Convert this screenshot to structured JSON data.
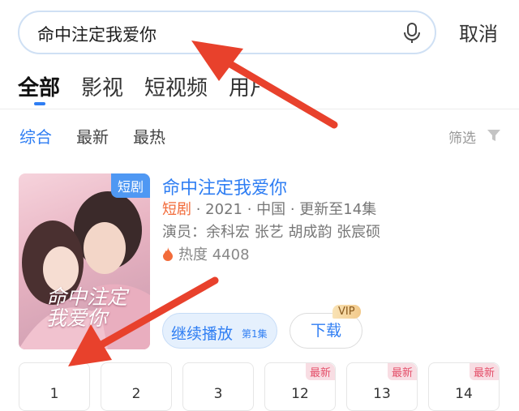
{
  "search": {
    "query": "命中注定我爱你",
    "cancel_label": "取消"
  },
  "tabs": [
    {
      "label": "全部",
      "active": true
    },
    {
      "label": "影视"
    },
    {
      "label": "短视频"
    },
    {
      "label": "用户"
    }
  ],
  "filters": [
    "综合",
    "最新",
    "最热"
  ],
  "sort_label": "筛选",
  "result": {
    "badge": "短剧",
    "poster_text": "命中注定\n我爱你",
    "title": "命中注定我爱你",
    "genre": "短剧",
    "meta_rest": " · 2021 · 中国 · 更新至14集",
    "cast": "演员：余科宏 张艺 胡成韵 张宸硕",
    "heat": "热度 4408",
    "play_label": "继续播放",
    "play_sub": "第1集",
    "download_label": "下载",
    "vip_label": "VIP"
  },
  "episodes": [
    {
      "num": "1"
    },
    {
      "num": "2"
    },
    {
      "num": "3"
    },
    {
      "num": "12",
      "tag": "最新"
    },
    {
      "num": "13",
      "tag": "最新"
    },
    {
      "num": "14",
      "tag": "最新"
    }
  ],
  "colors": {
    "accent": "#2f7ef3",
    "genre": "#f26b3a",
    "arrow": "#e8412c"
  }
}
